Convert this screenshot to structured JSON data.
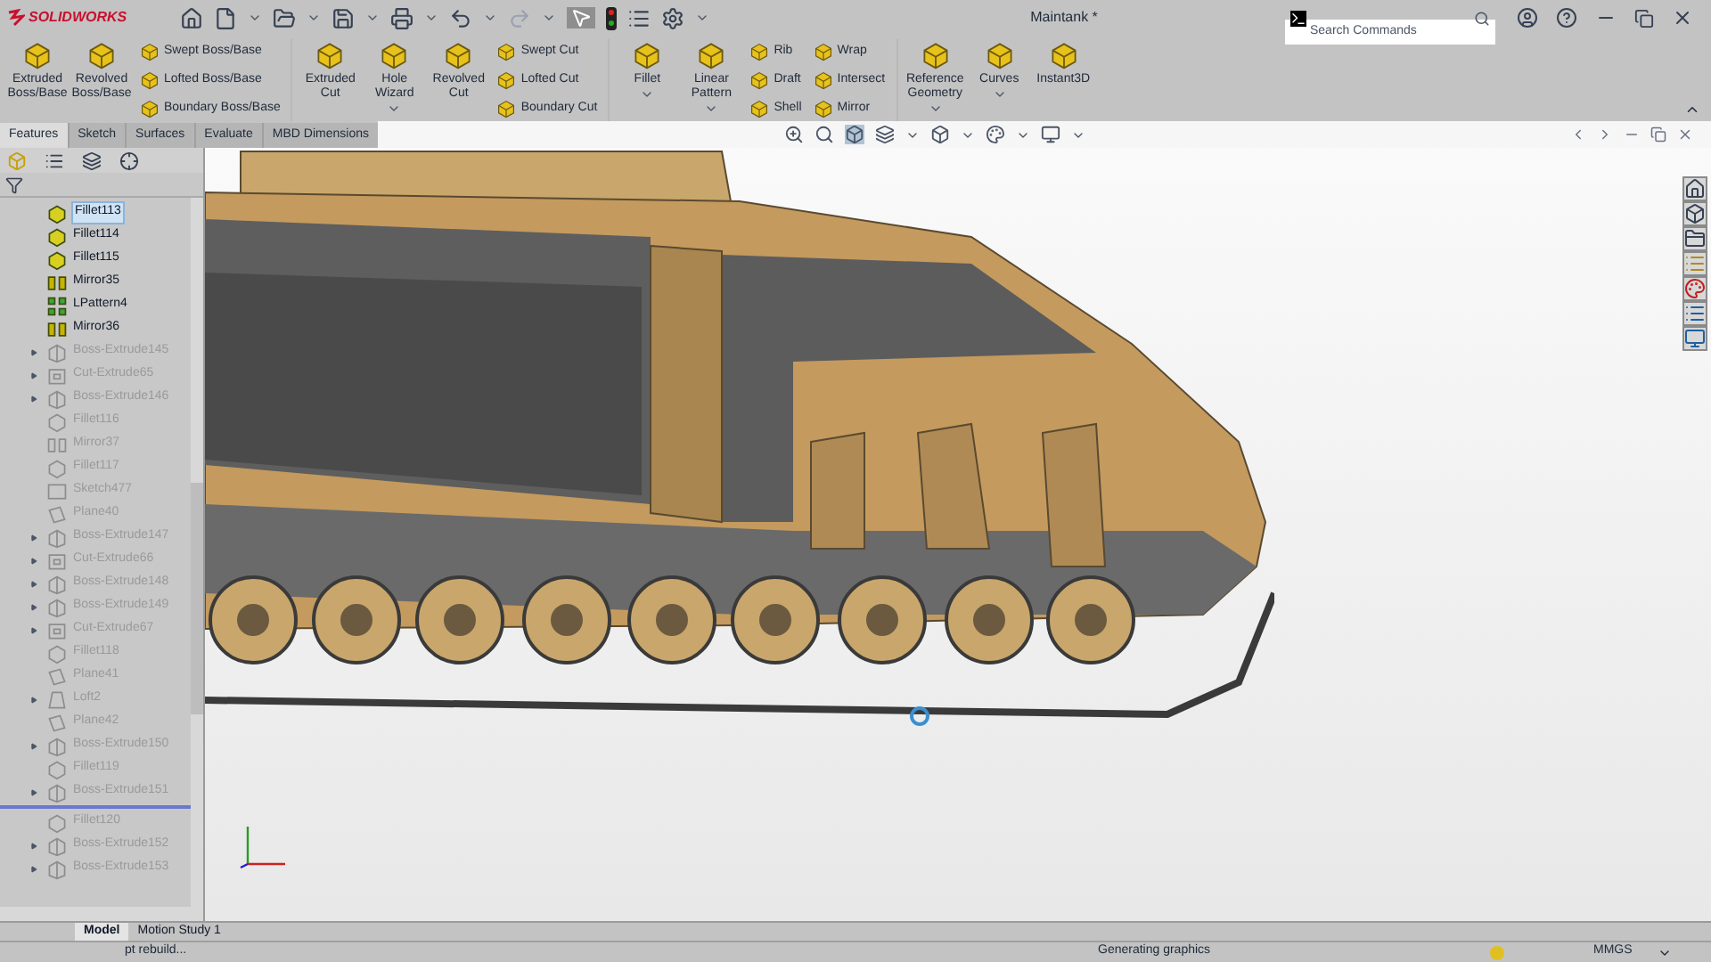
{
  "window": {
    "app_name": "SOLIDWORKS",
    "title": "Maintank *"
  },
  "search": {
    "placeholder": "Search Commands"
  },
  "ribbon": [
    {
      "kind": "large",
      "label": "Extruded Boss/Base",
      "dropdown": false
    },
    {
      "kind": "large",
      "label": "Revolved Boss/Base",
      "dropdown": false
    },
    {
      "kind": "stack",
      "items": [
        "Swept Boss/Base",
        "Lofted Boss/Base",
        "Boundary Boss/Base"
      ]
    },
    {
      "kind": "separator"
    },
    {
      "kind": "large",
      "label": "Extruded Cut",
      "dropdown": false
    },
    {
      "kind": "large",
      "label": "Hole Wizard",
      "dropdown": true
    },
    {
      "kind": "large",
      "label": "Revolved Cut",
      "dropdown": false
    },
    {
      "kind": "stack",
      "items": [
        "Swept Cut",
        "Lofted Cut",
        "Boundary Cut"
      ]
    },
    {
      "kind": "separator"
    },
    {
      "kind": "large",
      "label": "Fillet",
      "dropdown": true
    },
    {
      "kind": "large",
      "label": "Linear Pattern",
      "dropdown": true
    },
    {
      "kind": "stack",
      "items": [
        "Rib",
        "Draft",
        "Shell"
      ]
    },
    {
      "kind": "stack",
      "items": [
        "Wrap",
        "Intersect",
        "Mirror"
      ]
    },
    {
      "kind": "separator"
    },
    {
      "kind": "large",
      "label": "Reference Geometry",
      "dropdown": true
    },
    {
      "kind": "large",
      "label": "Curves",
      "dropdown": true
    },
    {
      "kind": "large",
      "label": "Instant3D",
      "dropdown": false
    }
  ],
  "tabs": [
    {
      "label": "Features",
      "selected": true
    },
    {
      "label": "Sketch",
      "selected": false
    },
    {
      "label": "Surfaces",
      "selected": false
    },
    {
      "label": "Evaluate",
      "selected": false
    },
    {
      "label": "MBD Dimensions",
      "selected": false
    }
  ],
  "feature_tree": [
    {
      "kind": "fillet",
      "label": "Fillet113",
      "selected": true,
      "suppressed": false,
      "expandable": false
    },
    {
      "kind": "fillet",
      "label": "Fillet114",
      "selected": false,
      "suppressed": false,
      "expandable": false
    },
    {
      "kind": "fillet",
      "label": "Fillet115",
      "selected": false,
      "suppressed": false,
      "expandable": false
    },
    {
      "kind": "mirror",
      "label": "Mirror35",
      "selected": false,
      "suppressed": false,
      "expandable": false
    },
    {
      "kind": "pattern",
      "label": "LPattern4",
      "selected": false,
      "suppressed": false,
      "expandable": false
    },
    {
      "kind": "mirror",
      "label": "Mirror36",
      "selected": false,
      "suppressed": false,
      "expandable": false
    },
    {
      "kind": "extrude",
      "label": "Boss-Extrude145",
      "selected": false,
      "suppressed": true,
      "expandable": true
    },
    {
      "kind": "cut",
      "label": "Cut-Extrude65",
      "selected": false,
      "suppressed": true,
      "expandable": true
    },
    {
      "kind": "extrude",
      "label": "Boss-Extrude146",
      "selected": false,
      "suppressed": true,
      "expandable": true
    },
    {
      "kind": "fillet",
      "label": "Fillet116",
      "selected": false,
      "suppressed": true,
      "expandable": false
    },
    {
      "kind": "mirror",
      "label": "Mirror37",
      "selected": false,
      "suppressed": true,
      "expandable": false
    },
    {
      "kind": "fillet",
      "label": "Fillet117",
      "selected": false,
      "suppressed": true,
      "expandable": false
    },
    {
      "kind": "sketch",
      "label": "Sketch477",
      "selected": false,
      "suppressed": true,
      "expandable": false
    },
    {
      "kind": "plane",
      "label": "Plane40",
      "selected": false,
      "suppressed": true,
      "expandable": false
    },
    {
      "kind": "extrude",
      "label": "Boss-Extrude147",
      "selected": false,
      "suppressed": true,
      "expandable": true
    },
    {
      "kind": "cut",
      "label": "Cut-Extrude66",
      "selected": false,
      "suppressed": true,
      "expandable": true
    },
    {
      "kind": "extrude",
      "label": "Boss-Extrude148",
      "selected": false,
      "suppressed": true,
      "expandable": true
    },
    {
      "kind": "extrude",
      "label": "Boss-Extrude149",
      "selected": false,
      "suppressed": true,
      "expandable": true
    },
    {
      "kind": "cut",
      "label": "Cut-Extrude67",
      "selected": false,
      "suppressed": true,
      "expandable": true
    },
    {
      "kind": "fillet",
      "label": "Fillet118",
      "selected": false,
      "suppressed": true,
      "expandable": false
    },
    {
      "kind": "plane",
      "label": "Plane41",
      "selected": false,
      "suppressed": true,
      "expandable": false
    },
    {
      "kind": "loft",
      "label": "Loft2",
      "selected": false,
      "suppressed": true,
      "expandable": true
    },
    {
      "kind": "plane",
      "label": "Plane42",
      "selected": false,
      "suppressed": true,
      "expandable": false
    },
    {
      "kind": "extrude",
      "label": "Boss-Extrude150",
      "selected": false,
      "suppressed": true,
      "expandable": true
    },
    {
      "kind": "fillet",
      "label": "Fillet119",
      "selected": false,
      "suppressed": true,
      "expandable": false
    },
    {
      "kind": "extrude",
      "label": "Boss-Extrude151",
      "selected": false,
      "suppressed": true,
      "expandable": true
    },
    {
      "kind": "rollback_bar"
    },
    {
      "kind": "fillet",
      "label": "Fillet120",
      "selected": false,
      "suppressed": true,
      "expandable": false
    },
    {
      "kind": "extrude",
      "label": "Boss-Extrude152",
      "selected": false,
      "suppressed": true,
      "expandable": true
    },
    {
      "kind": "extrude",
      "label": "Boss-Extrude153",
      "selected": false,
      "suppressed": true,
      "expandable": true
    }
  ],
  "bottom_tabs": [
    {
      "label": "Model",
      "selected": true
    },
    {
      "label": "Motion Study 1",
      "selected": false
    }
  ],
  "status_bar": {
    "left": "pt rebuild...",
    "center": "Generating graphics",
    "units": "MMGS"
  }
}
